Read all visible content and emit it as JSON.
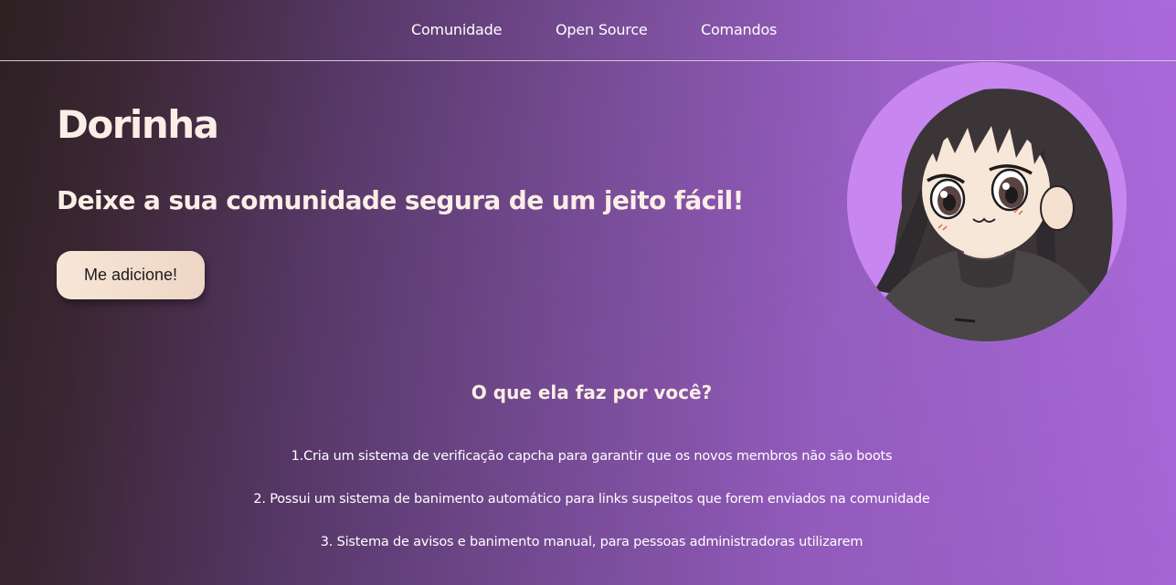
{
  "nav": {
    "items": [
      {
        "label": "Comunidade"
      },
      {
        "label": "Open Source"
      },
      {
        "label": "Comandos"
      }
    ]
  },
  "hero": {
    "title": "Dorinha",
    "tagline": "Deixe a sua comunidade segura de um jeito fácil!",
    "button_label": "Me adicione!"
  },
  "features": {
    "title": "O que ela faz por você?",
    "items": [
      "1.Cria um sistema de verificação capcha para garantir que os novos membros não são boots",
      "2. Possui um sistema de banimento automático para links suspeitos que forem enviados na comunidade",
      "3. Sistema de avisos e banimento manual, para pessoas administradoras utilizarem"
    ]
  },
  "colors": {
    "accent_light": "#fbeee6",
    "button_bg": "#f3e0d0",
    "gradient_start": "#2d2022",
    "gradient_end": "#b36ee6",
    "avatar_bg": "#c786f0"
  },
  "icons": {
    "avatar": "anime-girl-avatar"
  }
}
